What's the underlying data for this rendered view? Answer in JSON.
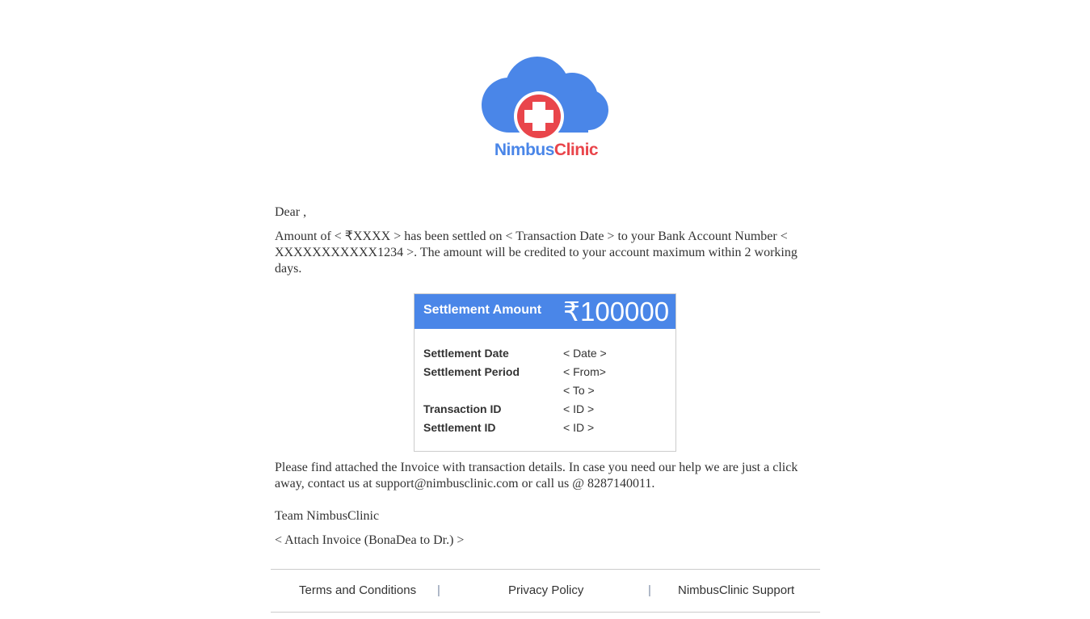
{
  "brand": {
    "part1": "Nimbus",
    "part2": "Clinic"
  },
  "greeting": "Dear ,",
  "message": "Amount of < ₹XXXX > has been settled on < Transaction Date > to your Bank Account Number < XXXXXXXXXXX1234 >. The amount will be credited to your account maximum within 2 working days.",
  "card": {
    "header_label": "Settlement Amount",
    "amount": "₹100000",
    "rows": [
      {
        "label": "Settlement Date",
        "value": "< Date >"
      },
      {
        "label": "Settlement Period",
        "value": "< From>"
      },
      {
        "label": "",
        "value": "< To >"
      },
      {
        "label": "Transaction ID",
        "value": "< ID >"
      },
      {
        "label": "Settlement ID",
        "value": "< ID >"
      }
    ]
  },
  "help_text": "Please find attached the Invoice with transaction details. In case you need our help we are just a click away, contact us at support@nimbusclinic.com or call us @ 8287140011.",
  "signoff": "Team NimbusClinic",
  "attach_note": "< Attach Invoice (BonaDea to Dr.) >",
  "footer": {
    "terms": "Terms and Conditions",
    "privacy": "Privacy Policy",
    "support": "NimbusClinic Support",
    "separator": "|"
  },
  "colors": {
    "accent": "#4a86e8",
    "brand_red": "#e9454b",
    "text": "#333333"
  }
}
